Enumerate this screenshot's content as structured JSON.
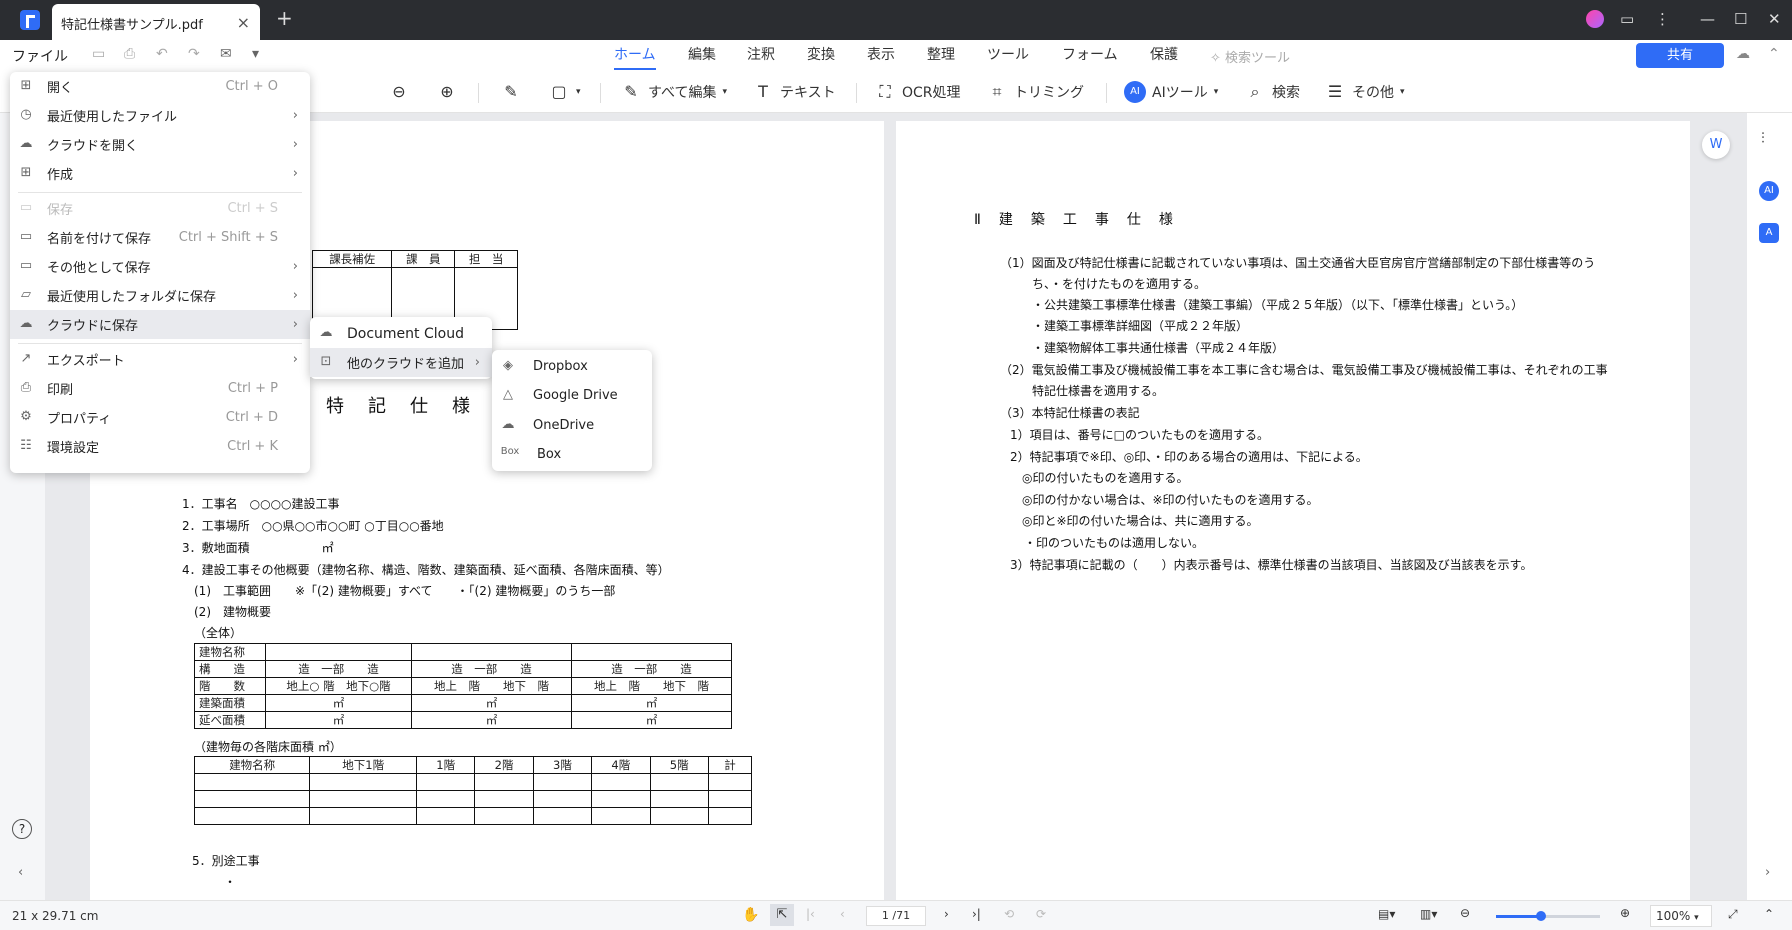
{
  "window": {
    "tab_title": "特記仕様書サンプル.pdf"
  },
  "menubar": {
    "file": "ファイル",
    "tabs": [
      "ホーム",
      "編集",
      "注釈",
      "変換",
      "表示",
      "整理",
      "ツール",
      "フォーム",
      "保護"
    ],
    "search_tools": "検索ツール",
    "share": "共有"
  },
  "toolbar": {
    "edit_all": "すべて編集",
    "text": "テキスト",
    "ocr": "OCR処理",
    "trim": "トリミング",
    "ai_tools": "AIツール",
    "search": "検索",
    "more": "その他"
  },
  "file_menu": {
    "items": [
      {
        "label": "開く",
        "shortcut": "Ctrl + O"
      },
      {
        "label": "最近使用したファイル",
        "shortcut": ""
      },
      {
        "label": "クラウドを開く",
        "shortcut": ""
      },
      {
        "label": "作成",
        "shortcut": ""
      },
      {
        "label": "保存",
        "shortcut": "Ctrl + S"
      },
      {
        "label": "名前を付けて保存",
        "shortcut": "Ctrl + Shift + S"
      },
      {
        "label": "その他として保存",
        "shortcut": ""
      },
      {
        "label": "最近使用したフォルダに保存",
        "shortcut": ""
      },
      {
        "label": "クラウドに保存",
        "shortcut": ""
      },
      {
        "label": "エクスポート",
        "shortcut": ""
      },
      {
        "label": "印刷",
        "shortcut": "Ctrl + P"
      },
      {
        "label": "プロパティ",
        "shortcut": "Ctrl + D"
      },
      {
        "label": "環境設定",
        "shortcut": "Ctrl + K"
      }
    ]
  },
  "cloud_submenu": {
    "items": [
      "Document Cloud",
      "他のクラウドを追加"
    ]
  },
  "other_cloud_submenu": {
    "items": [
      "Dropbox",
      "Google Drive",
      "OneDrive",
      "Box"
    ],
    "box_badge": "Box"
  },
  "page_left": {
    "approval_headers": [
      "課長補佐",
      "課　員",
      "担　当"
    ],
    "title": "特　記　仕　様　書",
    "lines": [
      "1．工事名　○○○○建設工事",
      "2．工事場所　○○県○○市○○町 ○丁目○○番地",
      "3．敷地面積　　　　　　㎡",
      "4．建設工事その他概要（建物名称、構造、階数、建築面積、延べ面積、各階床面積、等）",
      "(1)　工事範囲　　※「(2) 建物概要」すべて　　・「(2) 建物概要」のうち一部",
      "(2)　建物概要",
      "（全体）",
      "（建物毎の各階床面積 ㎡）",
      "5．別途工事",
      "・"
    ],
    "table1": [
      [
        "建物名称",
        "",
        "",
        ""
      ],
      [
        "構　　造",
        "造　一部　　造",
        "造　一部　　造",
        "造　一部　　造"
      ],
      [
        "階　　数",
        "地上○ 階　地下○階",
        "地上　階　　地下　階",
        "地上　階　　地下　階"
      ],
      [
        "建築面積",
        "㎡",
        "㎡",
        "㎡"
      ],
      [
        "延べ面積",
        "㎡",
        "㎡",
        "㎡"
      ]
    ],
    "table2_headers": [
      "建物名称",
      "地下1階",
      "1階",
      "2階",
      "3階",
      "4階",
      "5階",
      "計"
    ]
  },
  "page_right": {
    "heading": "Ⅱ　建　築　工　事　仕　様",
    "lines": [
      "（1）図面及び特記仕様書に記載されていない事項は、国土交通省大臣官房官庁営繕部制定の下部仕様書等のう",
      "ち、・を付けたものを適用する。",
      "・公共建築工事標準仕様書（建築工事編）（平成２５年版）（以下、「標準仕様書」という。）",
      "・建築工事標準詳細図（平成２２年版）",
      "・建築物解体工事共通仕様書（平成２４年版）",
      "（2）電気設備工事及び機械設備工事を本工事に含む場合は、電気設備工事及び機械設備工事は、それぞれの工事",
      "特記仕様書を適用する。",
      "（3）本特記仕様書の表記",
      "1）項目は、番号に□のついたものを適用する。",
      "2）特記事項で※印、◎印、・印のある場合の適用は、下記による。",
      "◎印の付いたものを適用する。",
      "◎印の付かない場合は、※印の付いたものを適用する。",
      "◎印と※印の付いた場合は、共に適用する。",
      "・印のついたものは適用しない。",
      "3）特記事項に記載の（　　）内表示番号は、標準仕様書の当該項目、当該図及び当該表を示す。"
    ]
  },
  "statusbar": {
    "page_size": "21 x 29.71 cm",
    "page_indicator": "1 /71",
    "zoom": "100%"
  }
}
